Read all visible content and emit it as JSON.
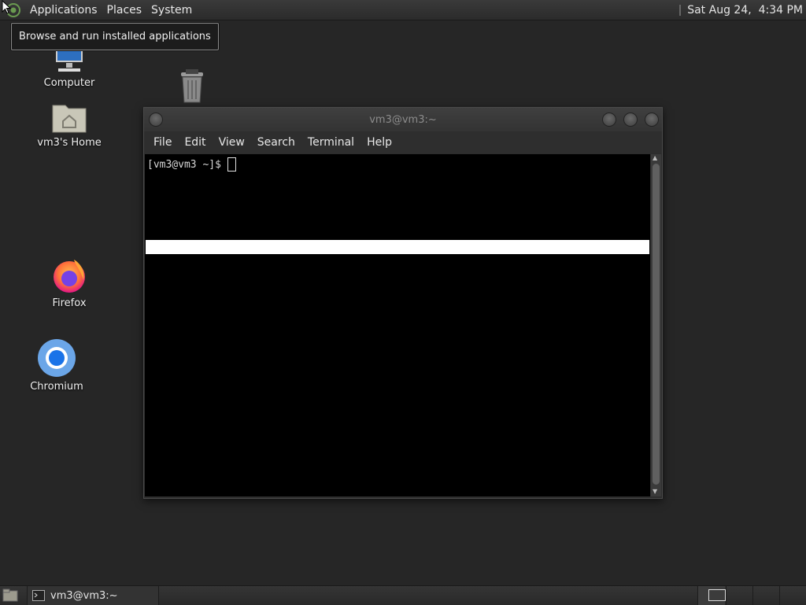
{
  "top_panel": {
    "menus": [
      "Applications",
      "Places",
      "System"
    ],
    "clock": "Sat Aug 24,  4:34 PM"
  },
  "tooltip": {
    "text": "Browse and run installed applications"
  },
  "desktop_icons": {
    "computer": "Computer",
    "home": "vm3's Home",
    "firefox": "Firefox",
    "chromium": "Chromium"
  },
  "terminal": {
    "title": "vm3@vm3:~",
    "menus": [
      "File",
      "Edit",
      "View",
      "Search",
      "Terminal",
      "Help"
    ],
    "prompt": "[vm3@vm3 ~]$"
  },
  "taskbar": {
    "task_label": "vm3@vm3:~"
  }
}
